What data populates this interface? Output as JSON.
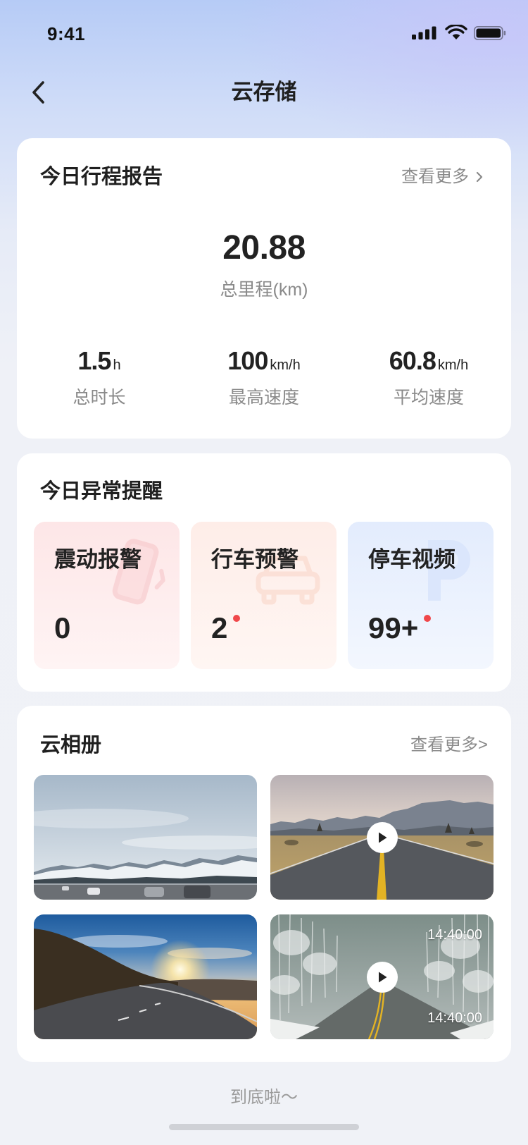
{
  "status_bar": {
    "time": "9:41",
    "icons": [
      "signal-icon",
      "wifi-icon",
      "battery-icon"
    ]
  },
  "header": {
    "title": "云存储",
    "back_icon": "chevron-left-icon"
  },
  "trip_report": {
    "title": "今日行程报告",
    "more_label": "查看更多",
    "more_icon": "chevron-right-icon",
    "total_distance": {
      "value": "20.88",
      "label": "总里程(km)"
    },
    "stats": [
      {
        "value": "1.5",
        "unit": "h",
        "label": "总时长"
      },
      {
        "value": "100",
        "unit": "km/h",
        "label": "最高速度"
      },
      {
        "value": "60.8",
        "unit": "km/h",
        "label": "平均速度"
      }
    ]
  },
  "alerts": {
    "title": "今日异常提醒",
    "tiles": [
      {
        "label": "震动报警",
        "count": "0",
        "has_new": false,
        "icon": "phone-vibration-icon"
      },
      {
        "label": "行车预警",
        "count": "2",
        "has_new": true,
        "icon": "car-icon"
      },
      {
        "label": "停车视频",
        "count": "99+",
        "has_new": true,
        "icon": "parking-icon"
      }
    ]
  },
  "album": {
    "title": "云相册",
    "more_label": "查看更多>",
    "items": [
      {
        "overlay_icon": null
      },
      {
        "overlay_icon": "play-icon"
      },
      {
        "overlay_icon": null
      },
      {
        "overlay_icon": "play-icon",
        "timestamp_top": "14:40:00",
        "timestamp_bottom": "14:40:00"
      }
    ]
  },
  "footer": {
    "end_text": "到底啦～"
  },
  "colors": {
    "accent_red": "#f0474a",
    "text_primary": "#222222",
    "text_secondary": "#8a8a8a",
    "tile_vibration": "#fde6e7",
    "tile_driving": "#feede8",
    "tile_parking": "#e3ecfd"
  }
}
